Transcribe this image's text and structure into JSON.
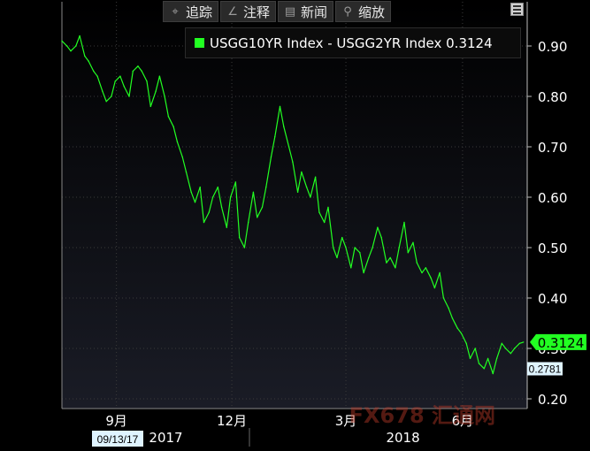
{
  "toolbar": {
    "buttons": [
      {
        "label": "追踪",
        "icon": "crosshair-icon"
      },
      {
        "label": "注释",
        "icon": "pencil-icon"
      },
      {
        "label": "新闻",
        "icon": "news-icon"
      },
      {
        "label": "缩放",
        "icon": "zoom-icon"
      }
    ]
  },
  "watermark": "FX678 汇通网",
  "chart_data": {
    "type": "line",
    "title": "",
    "xlabel": "",
    "ylabel": "",
    "ylim": [
      0.2,
      0.95
    ],
    "y_ticks": [
      "0.90",
      "0.80",
      "0.70",
      "0.60",
      "0.50",
      "0.40",
      "0.30",
      "0.20"
    ],
    "x_ticks": [
      {
        "label": "9月",
        "date": "2017-09-01"
      },
      {
        "label": "12月",
        "date": "2017-12-01"
      },
      {
        "label": "3月",
        "date": "2018-03-01"
      },
      {
        "label": "6月",
        "date": "2018-06-01"
      }
    ],
    "year_labels": [
      {
        "label": "2017",
        "date": "2017-10-10"
      },
      {
        "label": "2018",
        "date": "2018-04-15"
      }
    ],
    "date_badge": "09/13/17",
    "grid": true,
    "legend": "top-right",
    "colors": {
      "line": "#22ff22",
      "last_badge": "#22ff22",
      "secondary_badge": "#dff4ff"
    },
    "series": [
      {
        "name": "USGG10YR Index - USGG2YR Index",
        "legend_label": "USGG10YR Index - USGG2YR Index 0.3124",
        "last_value_label": "0.3124",
        "x": [
          "2017-07-20",
          "2017-07-24",
          "2017-07-27",
          "2017-07-31",
          "2017-08-03",
          "2017-08-07",
          "2017-08-10",
          "2017-08-14",
          "2017-08-17",
          "2017-08-21",
          "2017-08-24",
          "2017-08-28",
          "2017-08-31",
          "2017-09-04",
          "2017-09-07",
          "2017-09-11",
          "2017-09-14",
          "2017-09-18",
          "2017-09-21",
          "2017-09-25",
          "2017-09-28",
          "2017-10-02",
          "2017-10-05",
          "2017-10-09",
          "2017-10-12",
          "2017-10-16",
          "2017-10-19",
          "2017-10-23",
          "2017-10-26",
          "2017-10-30",
          "2017-11-02",
          "2017-11-06",
          "2017-11-09",
          "2017-11-13",
          "2017-11-16",
          "2017-11-20",
          "2017-11-23",
          "2017-11-27",
          "2017-11-30",
          "2017-12-04",
          "2017-12-07",
          "2017-12-11",
          "2017-12-14",
          "2017-12-18",
          "2017-12-21",
          "2017-12-25",
          "2017-12-28",
          "2018-01-01",
          "2018-01-04",
          "2018-01-08",
          "2018-01-11",
          "2018-01-15",
          "2018-01-18",
          "2018-01-22",
          "2018-01-25",
          "2018-01-29",
          "2018-02-01",
          "2018-02-05",
          "2018-02-08",
          "2018-02-12",
          "2018-02-15",
          "2018-02-19",
          "2018-02-22",
          "2018-02-26",
          "2018-03-01",
          "2018-03-05",
          "2018-03-08",
          "2018-03-12",
          "2018-03-15",
          "2018-03-19",
          "2018-03-22",
          "2018-03-26",
          "2018-03-29",
          "2018-04-02",
          "2018-04-05",
          "2018-04-09",
          "2018-04-12",
          "2018-04-16",
          "2018-04-19",
          "2018-04-23",
          "2018-04-26",
          "2018-04-30",
          "2018-05-03",
          "2018-05-07",
          "2018-05-10",
          "2018-05-14",
          "2018-05-17",
          "2018-05-21",
          "2018-05-24",
          "2018-05-28",
          "2018-05-31",
          "2018-06-04",
          "2018-06-07",
          "2018-06-11",
          "2018-06-14",
          "2018-06-18",
          "2018-06-21",
          "2018-06-25",
          "2018-06-28",
          "2018-07-02",
          "2018-07-05",
          "2018-07-09",
          "2018-07-12",
          "2018-07-16",
          "2018-07-19"
        ],
        "values": [
          0.91,
          0.9,
          0.89,
          0.9,
          0.92,
          0.88,
          0.87,
          0.85,
          0.84,
          0.81,
          0.79,
          0.8,
          0.83,
          0.84,
          0.82,
          0.8,
          0.85,
          0.86,
          0.85,
          0.83,
          0.78,
          0.81,
          0.84,
          0.8,
          0.76,
          0.74,
          0.71,
          0.68,
          0.65,
          0.61,
          0.59,
          0.62,
          0.55,
          0.57,
          0.6,
          0.62,
          0.58,
          0.54,
          0.6,
          0.63,
          0.52,
          0.5,
          0.55,
          0.61,
          0.56,
          0.58,
          0.62,
          0.68,
          0.72,
          0.78,
          0.74,
          0.7,
          0.67,
          0.61,
          0.65,
          0.62,
          0.6,
          0.64,
          0.57,
          0.55,
          0.58,
          0.5,
          0.48,
          0.52,
          0.5,
          0.46,
          0.5,
          0.49,
          0.45,
          0.48,
          0.5,
          0.54,
          0.52,
          0.47,
          0.48,
          0.46,
          0.5,
          0.55,
          0.49,
          0.51,
          0.47,
          0.45,
          0.46,
          0.44,
          0.42,
          0.45,
          0.4,
          0.38,
          0.36,
          0.34,
          0.33,
          0.31,
          0.28,
          0.3,
          0.27,
          0.26,
          0.28,
          0.25,
          0.28,
          0.31,
          0.3,
          0.29,
          0.3,
          0.31,
          0.3124
        ]
      }
    ],
    "annotations": [
      {
        "label": "0.2781",
        "value": 0.2781
      }
    ]
  }
}
